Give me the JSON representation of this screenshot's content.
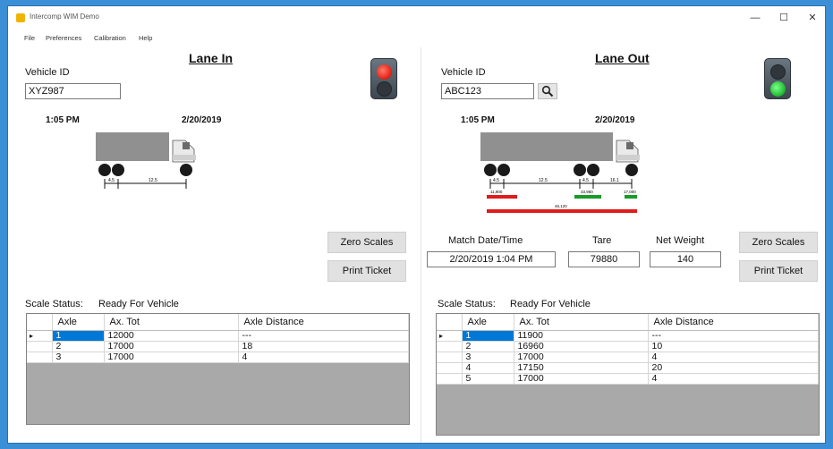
{
  "window": {
    "title": "Intercomp WIM Demo",
    "minimize": "—",
    "maximize": "☐",
    "close": "✕"
  },
  "menu": [
    "File",
    "Preferences",
    "Calibration",
    "Help"
  ],
  "lane_in": {
    "title": "Lane In",
    "vehicle_id_label": "Vehicle ID",
    "vehicle_id": "XYZ987",
    "time": "1:05 PM",
    "date": "2/20/2019",
    "light": "red",
    "dims": [
      "4.5",
      "12.5"
    ],
    "zero_scales": "Zero Scales",
    "print_ticket": "Print Ticket",
    "scale_status_label": "Scale Status:",
    "scale_status": "Ready For Vehicle",
    "columns": [
      "Axle",
      "Ax. Tot",
      "Axle Distance"
    ],
    "rows": [
      {
        "axle": "1",
        "tot": "12000",
        "dist": "---"
      },
      {
        "axle": "2",
        "tot": "17000",
        "dist": "18"
      },
      {
        "axle": "3",
        "tot": "17000",
        "dist": "4"
      }
    ]
  },
  "lane_out": {
    "title": "Lane Out",
    "vehicle_id_label": "Vehicle ID",
    "vehicle_id": "ABC123",
    "time": "1:05 PM",
    "date": "2/20/2019",
    "light": "green",
    "dims": [
      "4.5",
      "12.5",
      "4.5",
      "16.1"
    ],
    "weights": [
      "11,900",
      "33,960",
      "17,000",
      "46,120"
    ],
    "match_label": "Match Date/Time",
    "match_value": "2/20/2019 1:04 PM",
    "tare_label": "Tare",
    "tare_value": "79880",
    "net_label": "Net Weight",
    "net_value": "140",
    "zero_scales": "Zero Scales",
    "print_ticket": "Print Ticket",
    "scale_status_label": "Scale Status:",
    "scale_status": "Ready For Vehicle",
    "columns": [
      "Axle",
      "Ax. Tot",
      "Axle Distance"
    ],
    "rows": [
      {
        "axle": "1",
        "tot": "11900",
        "dist": "---"
      },
      {
        "axle": "2",
        "tot": "16960",
        "dist": "10"
      },
      {
        "axle": "3",
        "tot": "17000",
        "dist": "4"
      },
      {
        "axle": "4",
        "tot": "17150",
        "dist": "20"
      },
      {
        "axle": "5",
        "tot": "17000",
        "dist": "4"
      }
    ]
  },
  "colors": {
    "accent": "#0078d7",
    "red_light": "#e8281c",
    "green_light": "#27c23a",
    "overweight_bar": "#e01b1b",
    "ok_bar": "#1a9a2a"
  }
}
